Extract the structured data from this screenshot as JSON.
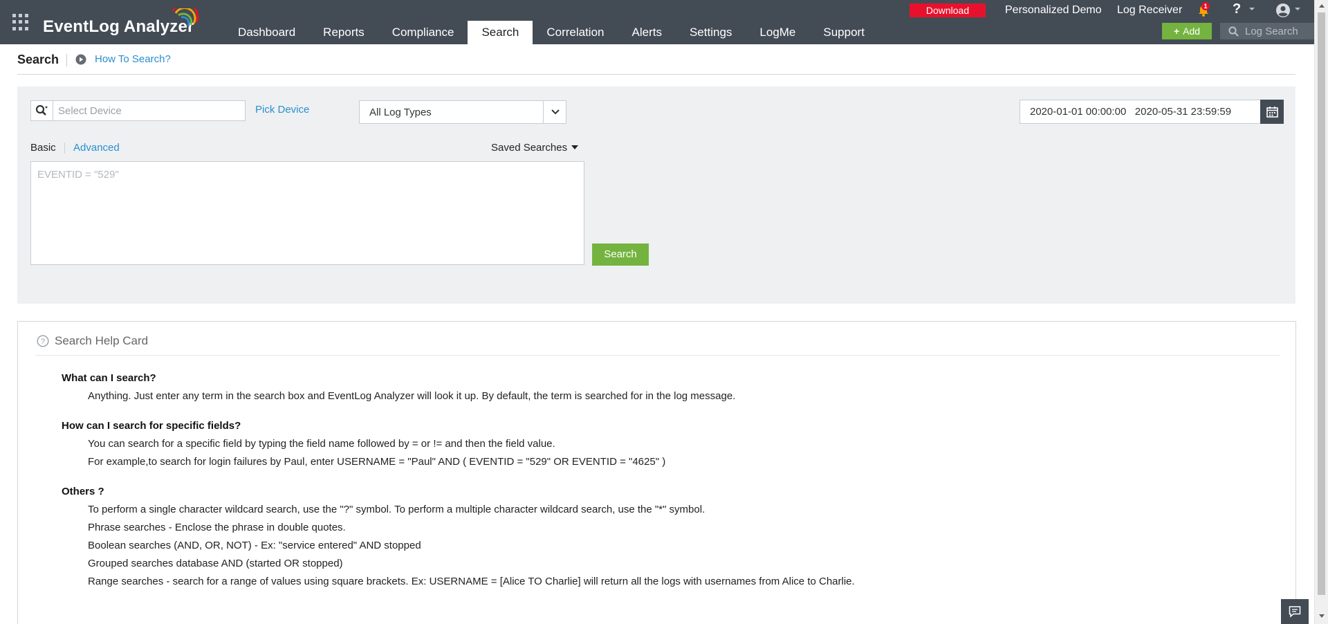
{
  "app": {
    "name": "EventLog Analyzer",
    "colors": {
      "topbar": "#434b55",
      "accent_green": "#74b33f",
      "link_blue": "#2a8fce",
      "download_red": "#e8112d"
    }
  },
  "nav": {
    "items": [
      {
        "label": "Dashboard"
      },
      {
        "label": "Reports"
      },
      {
        "label": "Compliance"
      },
      {
        "label": "Search",
        "active": true
      },
      {
        "label": "Correlation"
      },
      {
        "label": "Alerts"
      },
      {
        "label": "Settings"
      },
      {
        "label": "LogMe"
      },
      {
        "label": "Support"
      }
    ]
  },
  "topright": {
    "download_label": "Download",
    "personalized_demo": "Personalized Demo",
    "log_receiver": "Log Receiver",
    "notification_count": "1",
    "help_glyph": "?",
    "add_label": "Add",
    "log_search_placeholder": "Log Search"
  },
  "page": {
    "title": "Search",
    "howto_link": "How To Search?"
  },
  "search_panel": {
    "device_placeholder": "Select Device",
    "pick_device_label": "Pick Device",
    "log_type_selected": "All Log Types",
    "date_range": "2020-01-01 00:00:00   2020-05-31 23:59:59",
    "tab_basic": "Basic",
    "tab_advanced": "Advanced",
    "saved_searches_label": "Saved Searches",
    "query_placeholder": "EVENTID = \"529\"",
    "search_button": "Search"
  },
  "help_card": {
    "title": "Search Help Card",
    "sections": [
      {
        "question": "What can I search?",
        "answers": [
          "Anything. Just enter any term in the search box and EventLog Analyzer will look it up. By default, the term is searched for in the log message."
        ]
      },
      {
        "question": "How can I search for specific fields?",
        "answers": [
          "You can search for a specific field by typing the field name followed by = or != and then the field value.",
          "For example,to search for login failures by Paul, enter USERNAME = \"Paul\" AND ( EVENTID = \"529\" OR EVENTID = \"4625\" )"
        ]
      },
      {
        "question": "Others ?",
        "answers": [
          "To perform a single character wildcard search, use the \"?\" symbol. To perform a multiple character wildcard search, use the \"*\" symbol.",
          "Phrase searches - Enclose the phrase in double quotes.",
          "Boolean searches (AND, OR, NOT) - Ex: \"service entered\" AND stopped",
          "Grouped searches database AND (started OR stopped)",
          "Range searches - search for a range of values using square brackets. Ex: USERNAME = [Alice TO Charlie] will return all the logs with usernames from Alice to Charlie."
        ]
      }
    ]
  },
  "icons": [
    "apps-grid-icon",
    "logo-arc-icon",
    "bell-icon",
    "help-icon",
    "user-icon",
    "plus-icon",
    "search-icon",
    "play-circle-icon",
    "device-search-icon",
    "chevron-down-icon",
    "calendar-icon",
    "question-circle-icon",
    "chat-icon"
  ]
}
